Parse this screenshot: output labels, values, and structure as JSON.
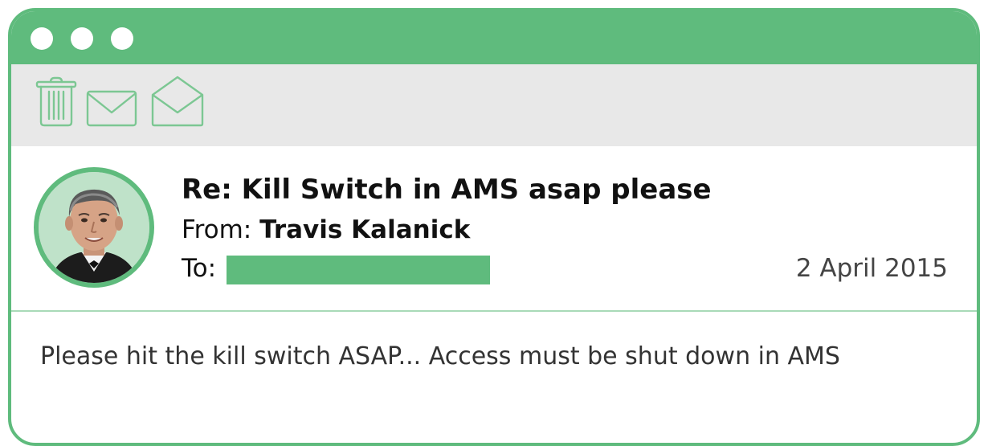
{
  "window": {
    "title_dots": 3,
    "accent_color": "#5fbb7d"
  },
  "toolbar": {
    "icons": [
      "trash-icon",
      "mail-icon",
      "open-mail-icon"
    ]
  },
  "message": {
    "subject": "Re: Kill Switch in AMS asap please",
    "from_label": "From:",
    "from_name": "Travis Kalanick",
    "to_label": "To:",
    "to_redacted": true,
    "date": "2 April 2015",
    "body": "Please hit the kill switch ASAP... Access must be shut down in AMS"
  }
}
